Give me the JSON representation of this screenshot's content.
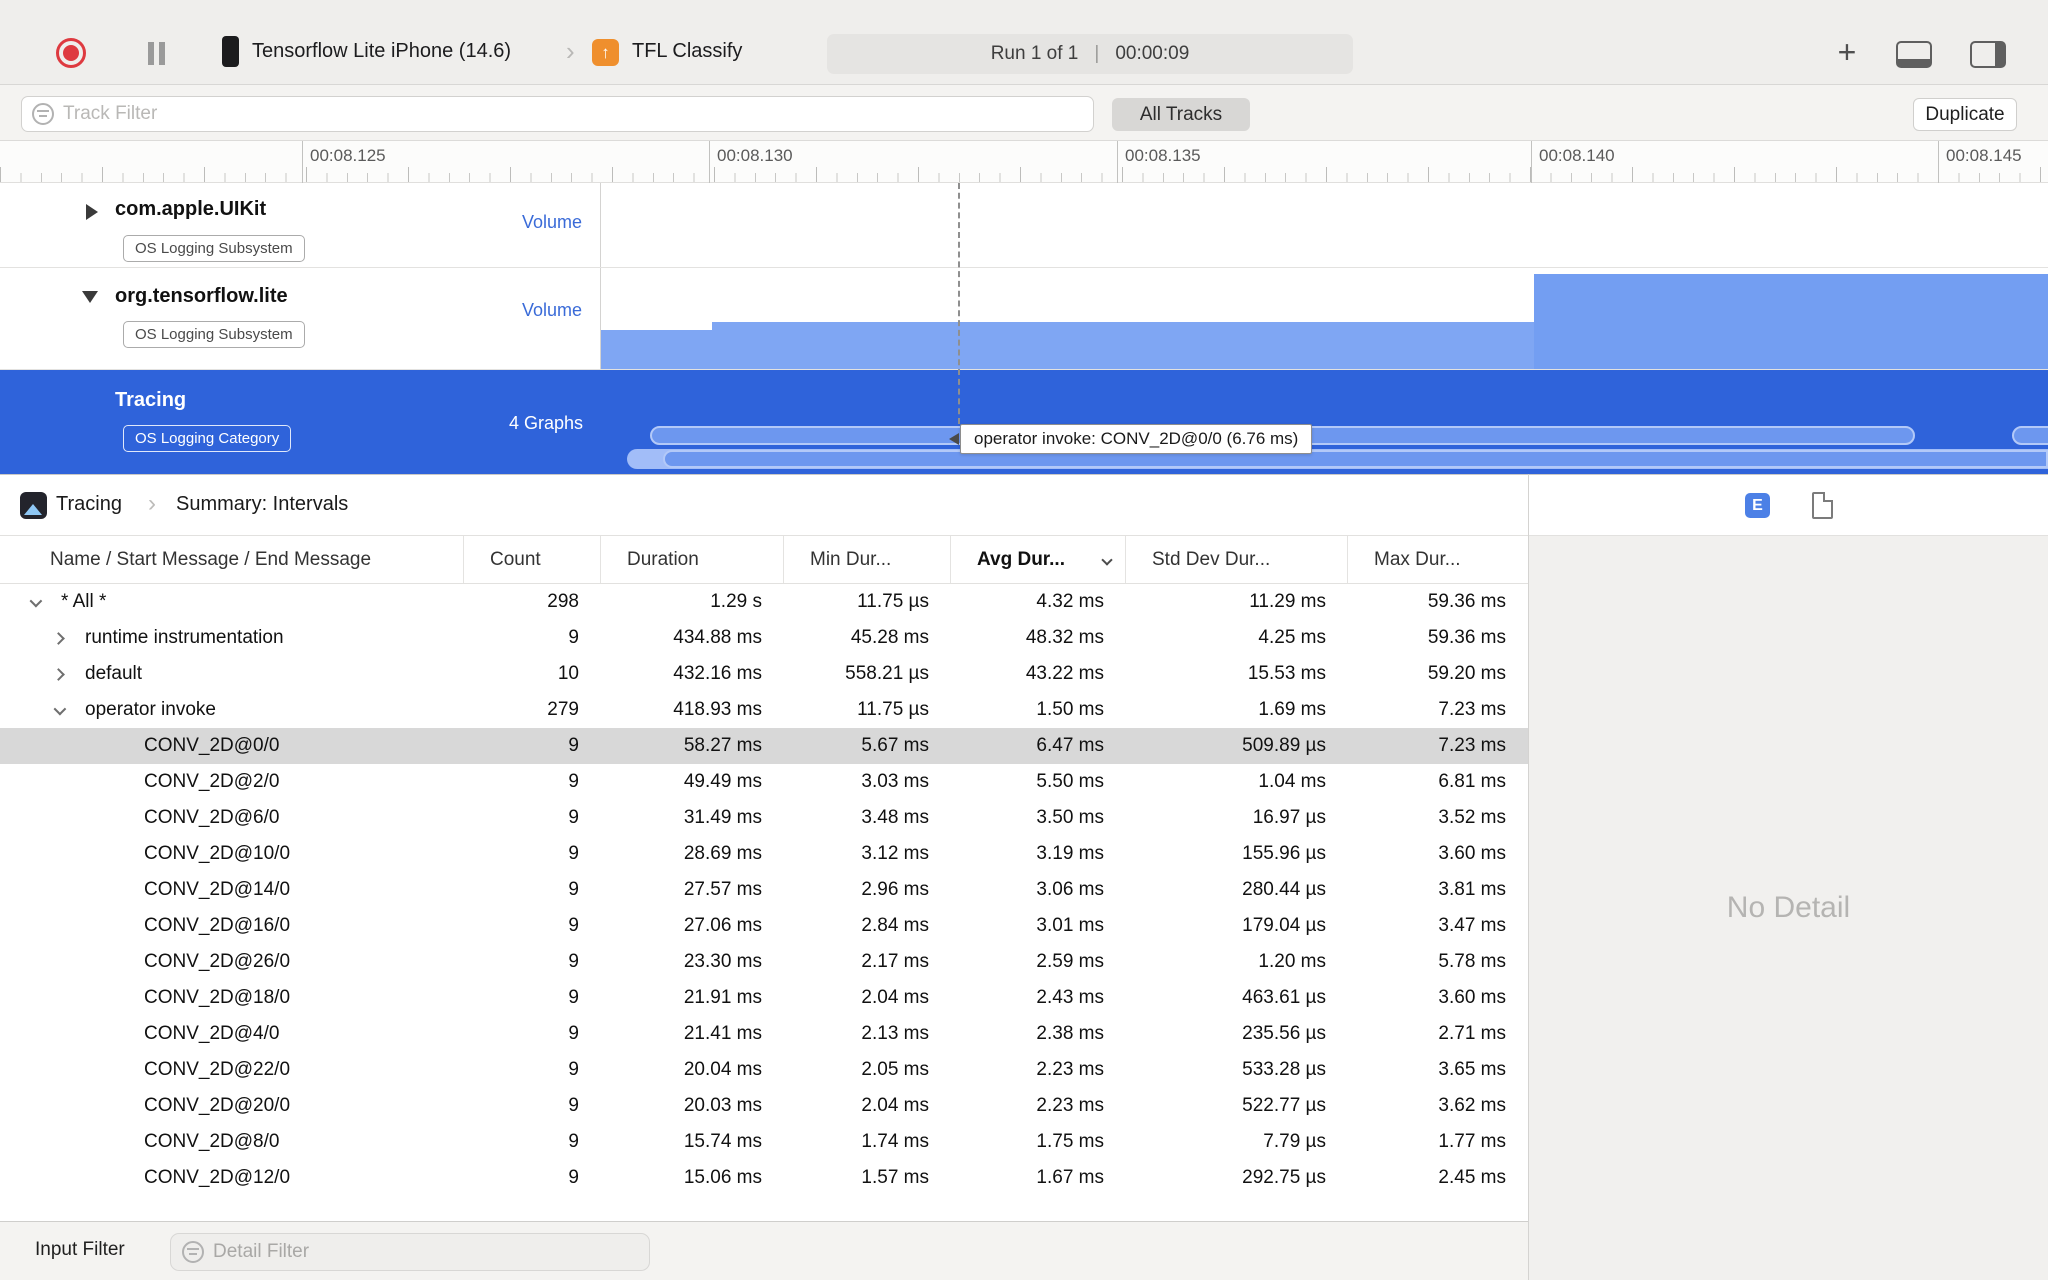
{
  "toolbar": {
    "device_name": "Tensorflow Lite iPhone (14.6)",
    "target_name": "TFL Classify",
    "target_icon_glyph": "↑",
    "run_label": "Run 1 of 1",
    "run_separator": "|",
    "run_time": "00:00:09",
    "plus_glyph": "+"
  },
  "filter_bar": {
    "track_filter_placeholder": "Track Filter",
    "all_tracks_label": "All Tracks",
    "duplicate_label": "Duplicate"
  },
  "ruler": {
    "labels": [
      "00:08.125",
      "00:08.130",
      "00:08.135",
      "00:08.140",
      "00:08.145"
    ]
  },
  "tracks": [
    {
      "title": "com.apple.UIKit",
      "badge": "OS Logging Subsystem",
      "meta": "Volume"
    },
    {
      "title": "org.tensorflow.lite",
      "badge": "OS Logging Subsystem",
      "meta": "Volume"
    },
    {
      "title": "Tracing",
      "badge": "OS Logging Category",
      "meta": "4 Graphs",
      "selected": true
    }
  ],
  "tooltip_text": "operator invoke: CONV_2D@0/0 (6.76 ms)",
  "jumpbar": {
    "root": "Tracing",
    "chevron": "›",
    "page": "Summary: Intervals",
    "extended_detail_glyph": "E"
  },
  "table": {
    "columns": [
      "Name / Start Message / End Message",
      "Count",
      "Duration",
      "Min Dur...",
      "Avg Dur...",
      "Std Dev Dur...",
      "Max Dur..."
    ],
    "sorted_column": "Avg Dur...",
    "rows": [
      {
        "level": 0,
        "expand": "down",
        "name": "* All *",
        "count": "298",
        "duration": "1.29 s",
        "min": "11.75 µs",
        "avg": "4.32 ms",
        "std": "11.29 ms",
        "max": "59.36 ms",
        "selected": false
      },
      {
        "level": 1,
        "expand": "right",
        "name": "runtime instrumentation",
        "count": "9",
        "duration": "434.88 ms",
        "min": "45.28 ms",
        "avg": "48.32 ms",
        "std": "4.25 ms",
        "max": "59.36 ms",
        "selected": false
      },
      {
        "level": 1,
        "expand": "right",
        "name": "default",
        "count": "10",
        "duration": "432.16 ms",
        "min": "558.21 µs",
        "avg": "43.22 ms",
        "std": "15.53 ms",
        "max": "59.20 ms",
        "selected": false
      },
      {
        "level": 1,
        "expand": "down",
        "name": "operator invoke",
        "count": "279",
        "duration": "418.93 ms",
        "min": "11.75 µs",
        "avg": "1.50 ms",
        "std": "1.69 ms",
        "max": "7.23 ms",
        "selected": false
      },
      {
        "level": 2,
        "expand": null,
        "name": "CONV_2D@0/0",
        "count": "9",
        "duration": "58.27 ms",
        "min": "5.67 ms",
        "avg": "6.47 ms",
        "std": "509.89 µs",
        "max": "7.23 ms",
        "selected": true
      },
      {
        "level": 2,
        "expand": null,
        "name": "CONV_2D@2/0",
        "count": "9",
        "duration": "49.49 ms",
        "min": "3.03 ms",
        "avg": "5.50 ms",
        "std": "1.04 ms",
        "max": "6.81 ms",
        "selected": false
      },
      {
        "level": 2,
        "expand": null,
        "name": "CONV_2D@6/0",
        "count": "9",
        "duration": "31.49 ms",
        "min": "3.48 ms",
        "avg": "3.50 ms",
        "std": "16.97 µs",
        "max": "3.52 ms",
        "selected": false
      },
      {
        "level": 2,
        "expand": null,
        "name": "CONV_2D@10/0",
        "count": "9",
        "duration": "28.69 ms",
        "min": "3.12 ms",
        "avg": "3.19 ms",
        "std": "155.96 µs",
        "max": "3.60 ms",
        "selected": false
      },
      {
        "level": 2,
        "expand": null,
        "name": "CONV_2D@14/0",
        "count": "9",
        "duration": "27.57 ms",
        "min": "2.96 ms",
        "avg": "3.06 ms",
        "std": "280.44 µs",
        "max": "3.81 ms",
        "selected": false
      },
      {
        "level": 2,
        "expand": null,
        "name": "CONV_2D@16/0",
        "count": "9",
        "duration": "27.06 ms",
        "min": "2.84 ms",
        "avg": "3.01 ms",
        "std": "179.04 µs",
        "max": "3.47 ms",
        "selected": false
      },
      {
        "level": 2,
        "expand": null,
        "name": "CONV_2D@26/0",
        "count": "9",
        "duration": "23.30 ms",
        "min": "2.17 ms",
        "avg": "2.59 ms",
        "std": "1.20 ms",
        "max": "5.78 ms",
        "selected": false
      },
      {
        "level": 2,
        "expand": null,
        "name": "CONV_2D@18/0",
        "count": "9",
        "duration": "21.91 ms",
        "min": "2.04 ms",
        "avg": "2.43 ms",
        "std": "463.61 µs",
        "max": "3.60 ms",
        "selected": false
      },
      {
        "level": 2,
        "expand": null,
        "name": "CONV_2D@4/0",
        "count": "9",
        "duration": "21.41 ms",
        "min": "2.13 ms",
        "avg": "2.38 ms",
        "std": "235.56 µs",
        "max": "2.71 ms",
        "selected": false
      },
      {
        "level": 2,
        "expand": null,
        "name": "CONV_2D@22/0",
        "count": "9",
        "duration": "20.04 ms",
        "min": "2.05 ms",
        "avg": "2.23 ms",
        "std": "533.28 µs",
        "max": "3.65 ms",
        "selected": false
      },
      {
        "level": 2,
        "expand": null,
        "name": "CONV_2D@20/0",
        "count": "9",
        "duration": "20.03 ms",
        "min": "2.04 ms",
        "avg": "2.23 ms",
        "std": "522.77 µs",
        "max": "3.62 ms",
        "selected": false
      },
      {
        "level": 2,
        "expand": null,
        "name": "CONV_2D@8/0",
        "count": "9",
        "duration": "15.74 ms",
        "min": "1.74 ms",
        "avg": "1.75 ms",
        "std": "7.79 µs",
        "max": "1.77 ms",
        "selected": false
      },
      {
        "level": 2,
        "expand": null,
        "name": "CONV_2D@12/0",
        "count": "9",
        "duration": "15.06 ms",
        "min": "1.57 ms",
        "avg": "1.67 ms",
        "std": "292.75 µs",
        "max": "2.45 ms",
        "selected": false
      }
    ]
  },
  "inspector": {
    "empty_text": "No Detail"
  },
  "bottom_bar": {
    "label": "Input Filter",
    "detail_filter_placeholder": "Detail Filter"
  },
  "icons": {
    "record": "record-icon",
    "pause": "pause-icon",
    "iphone": "device-icon",
    "filter": "filter-icon",
    "plus": "add-instrument-icon",
    "pane_bottom": "toggle-bottom-pane-icon",
    "pane_right": "toggle-right-pane-icon",
    "instrument": "tracing-instrument-icon",
    "extended_detail": "extended-detail-icon",
    "document": "document-icon"
  },
  "colors": {
    "selection_blue": "#2f63da",
    "bar_blue": "#7fa6f3",
    "pill_blue": "#6d97ef",
    "selected_row_gray": "#d8d8d8",
    "record_red": "#de3a40",
    "app_icon_orange": "#ef8f2d"
  }
}
